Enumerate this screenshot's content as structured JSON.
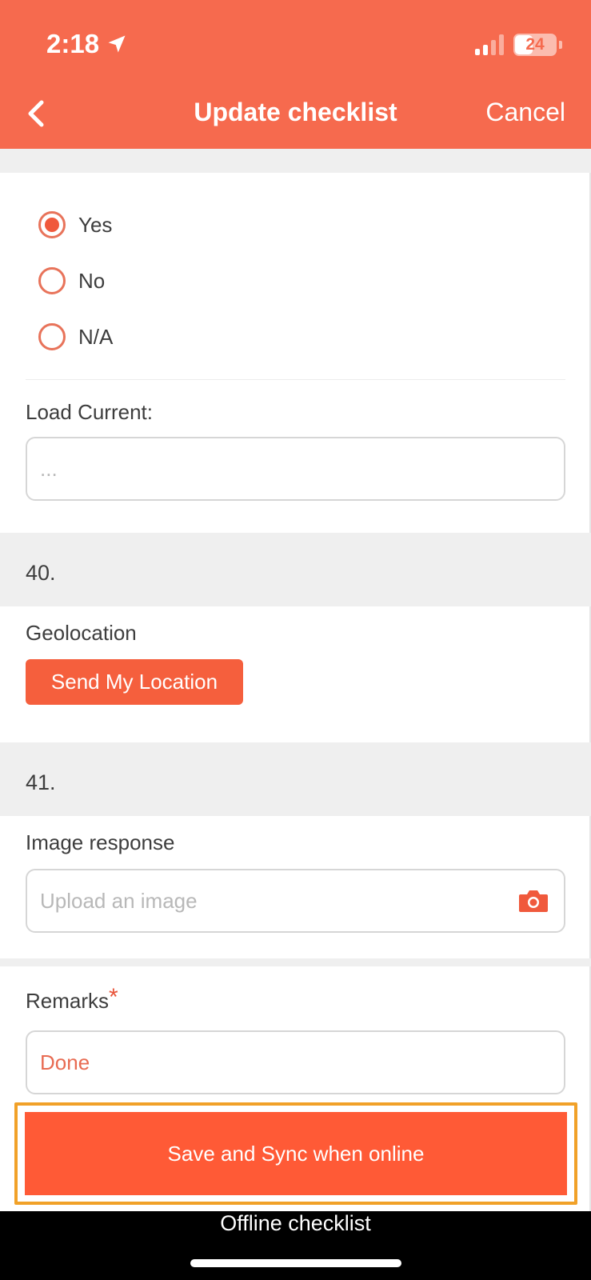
{
  "status_bar": {
    "time": "2:18",
    "battery": "24",
    "location_icon": "location-arrow-icon",
    "signal_icon": "cellular-signal-icon"
  },
  "nav": {
    "back_icon": "chevron-left-icon",
    "title": "Update checklist",
    "cancel_label": "Cancel"
  },
  "question_39": {
    "options": [
      {
        "label": "Yes",
        "selected": true
      },
      {
        "label": "No",
        "selected": false
      },
      {
        "label": "N/A",
        "selected": false
      }
    ],
    "load_current": {
      "label": "Load Current:",
      "placeholder": "..."
    }
  },
  "question_40": {
    "number": "40.",
    "label": "Geolocation",
    "button_label": "Send My Location"
  },
  "question_41": {
    "number": "41.",
    "label": "Image response",
    "placeholder": "Upload an image",
    "icon": "camera-icon"
  },
  "remarks": {
    "label": "Remarks",
    "required_mark": "*",
    "value": "Done"
  },
  "footer": {
    "save_label": "Save and Sync when online",
    "caption": "Offline checklist"
  },
  "colors": {
    "accent": "#f66a4e",
    "button": "#ff5a36",
    "highlight": "#f1a128"
  }
}
